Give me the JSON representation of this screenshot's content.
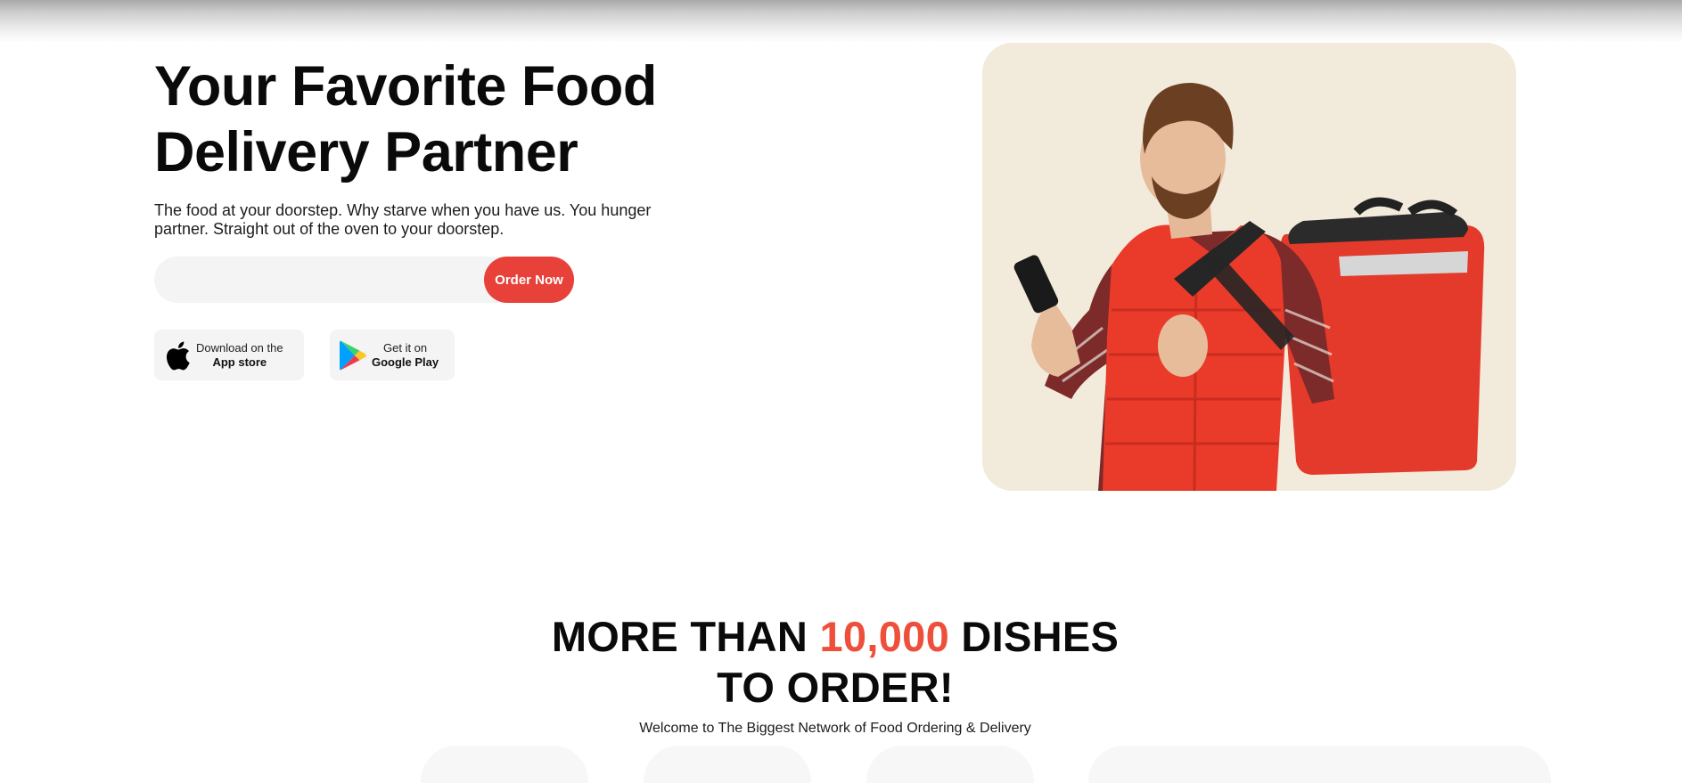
{
  "hero": {
    "title_line1": "Your Favorite Food",
    "title_line2": "Delivery Partner",
    "description": "The food at your doorstep. Why starve when you have us. You hunger partner. Straight out of the oven to your doorstep.",
    "order_input_placeholder": "",
    "order_button_label": "Order Now"
  },
  "stores": {
    "app_store": {
      "small": "Download on the",
      "big": "App store"
    },
    "google_play": {
      "small": "Get it on",
      "big": "Google Play"
    }
  },
  "dishes_section": {
    "title_prefix": "MORE THAN ",
    "title_accent": "10,000",
    "title_suffix": " DISHES",
    "title_line2": "TO ORDER!",
    "subtitle": "Welcome to The Biggest Network of Food Ordering & Delivery"
  },
  "colors": {
    "accent": "#e7413a",
    "accent_text": "#ee4f3a",
    "image_bg": "#f2eadb",
    "pill_bg": "#f4f4f4"
  },
  "icons": {
    "app_store": "apple-icon",
    "google_play": "google-play-icon",
    "hero_image": "delivery-man-illustration"
  }
}
